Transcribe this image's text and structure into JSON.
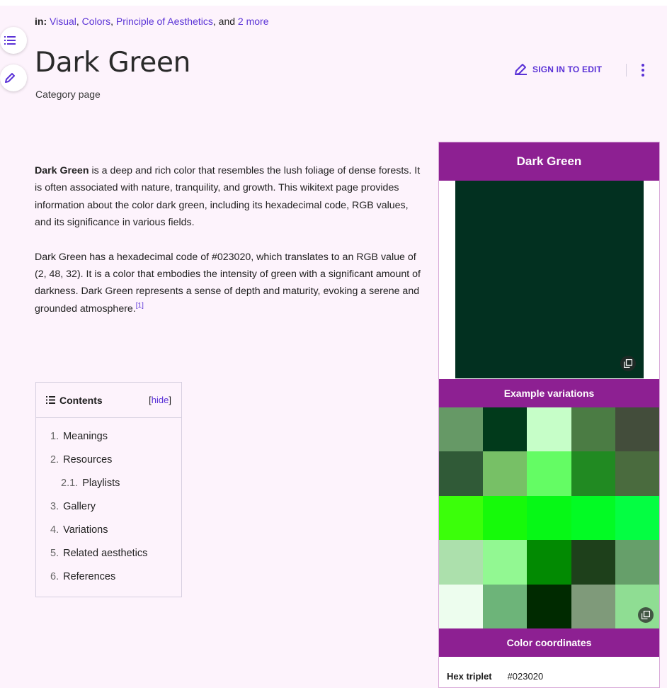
{
  "breadcrumb": {
    "label": "in:",
    "links": [
      "Visual",
      "Colors",
      "Principle of Aesthetics"
    ],
    "sep": ", ",
    "and": ", and ",
    "more": "2 more"
  },
  "page": {
    "title": "Dark Green",
    "subtitle": "Category page",
    "edit_label": "SIGN IN TO EDIT"
  },
  "content": {
    "p1_bold": "Dark Green",
    "p1_rest": " is a deep and rich color that resembles the lush foliage of dense forests. It is often associated with nature, tranquility, and growth. This wikitext page provides information about the color dark green, including its hexadecimal code, RGB values, and its significance in various fields.",
    "p2": "Dark Green has a hexadecimal code of #023020, which translates to an RGB value of (2, 48, 32). It is a color that embodies the intensity of green with a significant amount of darkness. Dark Green represents a sense of depth and maturity, evoking a serene and grounded atmosphere.",
    "p2_ref": "[1]"
  },
  "toc": {
    "title": "Contents",
    "hide_open": "[",
    "hide_label": "hide",
    "hide_close": "]",
    "items": [
      {
        "num": "1.",
        "label": "Meanings"
      },
      {
        "num": "2.",
        "label": "Resources"
      },
      {
        "num": "2.1.",
        "label": "Playlists"
      },
      {
        "num": "3.",
        "label": "Gallery"
      },
      {
        "num": "4.",
        "label": "Variations"
      },
      {
        "num": "5.",
        "label": "Related aesthetics"
      },
      {
        "num": "6.",
        "label": "References"
      }
    ]
  },
  "infobox": {
    "title": "Dark Green",
    "swatch_color": "#023020",
    "variations_title": "Example variations",
    "variation_colors": [
      "#669966",
      "#013a1b",
      "#c6fec8",
      "#4b7c44",
      "#434d3b",
      "#305a37",
      "#77c066",
      "#64fc64",
      "#218a22",
      "#4a6b3e",
      "#3bff0a",
      "#16fa0a",
      "#06f816",
      "#02fb24",
      "#04fe42",
      "#ace0ac",
      "#92f892",
      "#028a02",
      "#1e401b",
      "#669f6a",
      "#edfdee",
      "#6db479",
      "#002a00",
      "#7f9a7a",
      "#8fdd93"
    ],
    "coords_title": "Color coordinates",
    "hex_label": "Hex triplet",
    "hex_value": "#023020"
  },
  "colors": {
    "accent": "#5a32d6",
    "infobox_header": "#8d2092",
    "page_bg": "#fdf3fc"
  }
}
